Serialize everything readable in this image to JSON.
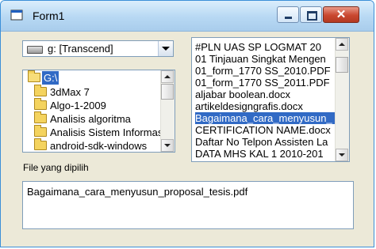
{
  "window": {
    "title": "Form1"
  },
  "drive_combo": {
    "value": "g: [Transcend]"
  },
  "dir_list": {
    "items": [
      {
        "label": "G:\\",
        "selected": true
      },
      {
        "label": "3dMax 7",
        "selected": false
      },
      {
        "label": "Algo-1-2009",
        "selected": false
      },
      {
        "label": "Analisis algoritma",
        "selected": false
      },
      {
        "label": "Analisis Sistem Informas",
        "selected": false
      },
      {
        "label": "android-sdk-windows",
        "selected": false
      }
    ]
  },
  "file_list": {
    "items": [
      {
        "label": "#PLN UAS SP LOGMAT  20",
        "selected": false
      },
      {
        "label": "01 Tinjauan Singkat Mengen",
        "selected": false
      },
      {
        "label": "01_form_1770 SS_2010.PDF",
        "selected": false
      },
      {
        "label": "01_form_1770 SS_2011.PDF",
        "selected": false
      },
      {
        "label": "aljabar boolean.docx",
        "selected": false
      },
      {
        "label": "artikeldesigngrafis.docx",
        "selected": false
      },
      {
        "label": "Bagaimana_cara_menyusun_",
        "selected": true
      },
      {
        "label": "CERTIFICATION NAME.docx",
        "selected": false
      },
      {
        "label": "Daftar No Telpon Assisten La",
        "selected": false
      },
      {
        "label": "DATA MHS KAL 1 2010-201",
        "selected": false
      }
    ]
  },
  "selected_label": "File yang dipilih",
  "selected_file": "Bagaimana_cara_menyusun_proposal_tesis.pdf"
}
